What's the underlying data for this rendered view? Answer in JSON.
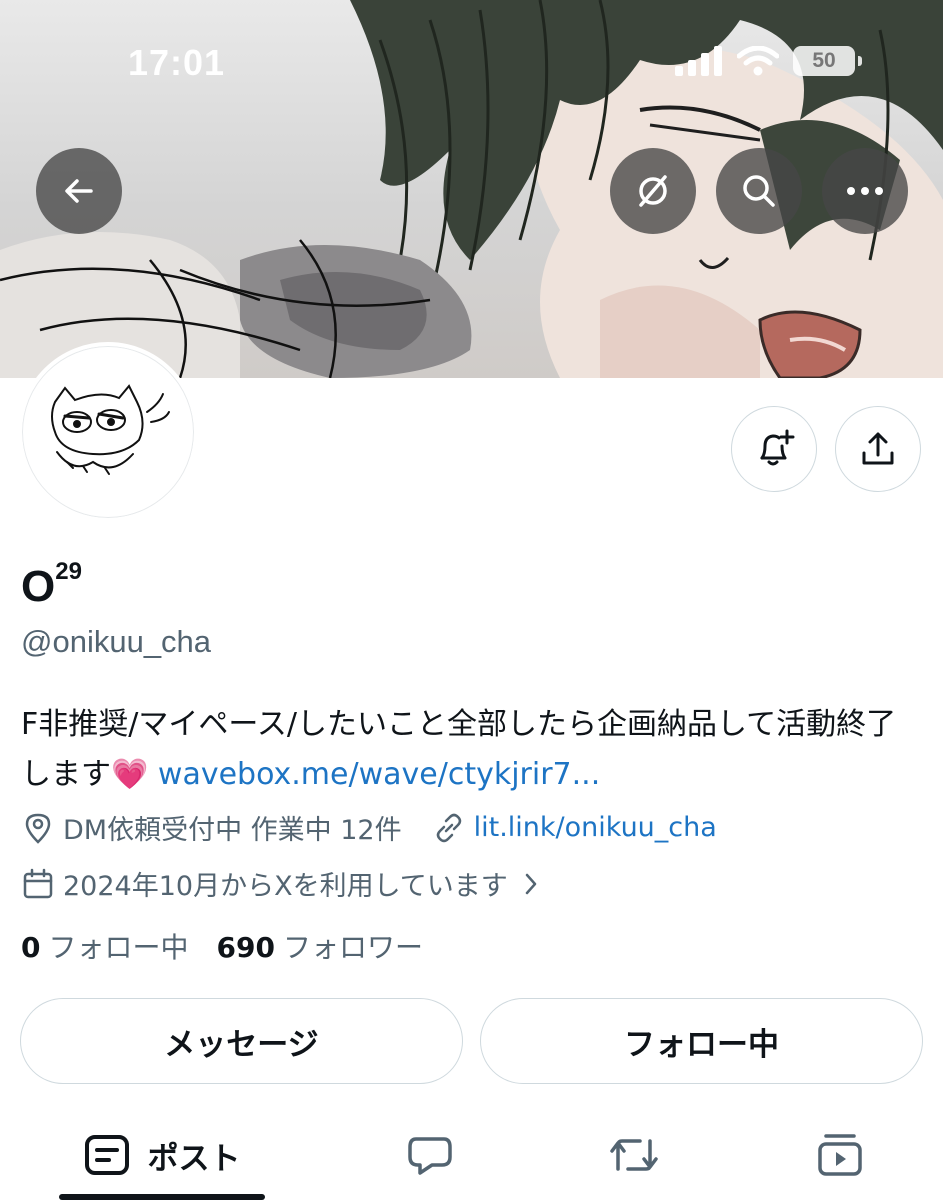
{
  "status_bar": {
    "time": "17:01",
    "battery": "50",
    "icons": [
      "signal-icon",
      "wifi-icon",
      "battery-icon"
    ]
  },
  "header": {
    "buttons": [
      "back-arrow-icon",
      "grok-icon",
      "search-icon",
      "more-icon"
    ]
  },
  "profile": {
    "display_name": "O",
    "display_name_sup": "29",
    "handle": "@onikuu_cha",
    "bio_text": "F非推奨/マイペース/したいこと全部したら企画納品して活動終了します",
    "bio_emoji": "💗",
    "bio_link": "wavebox.me/wave/ctykjrir7...",
    "location": "DM依頼受付中 作業中 12件",
    "website": "lit.link/onikuu_cha",
    "joined": "2024年10月からXを利用しています",
    "following_count": "0",
    "following_label": "フォロー中",
    "followers_count": "690",
    "followers_label": "フォロワー"
  },
  "actions": {
    "message": "メッセージ",
    "following": "フォロー中"
  },
  "tabs": {
    "posts": "ポスト",
    "active": "posts"
  },
  "colors": {
    "link": "#1d74c4",
    "text": "#0f1419",
    "secondary": "#536471",
    "border": "#cfd9de"
  }
}
